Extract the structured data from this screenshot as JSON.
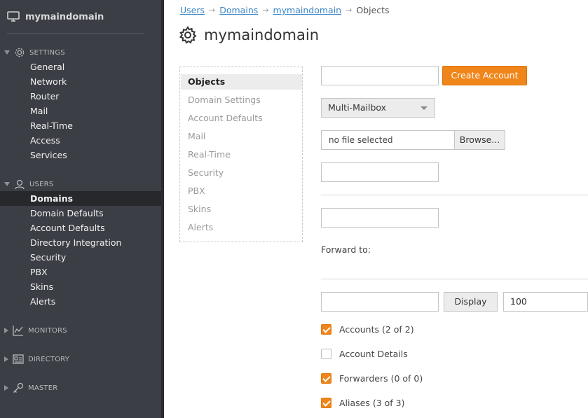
{
  "brand": {
    "name": "mymaindomain"
  },
  "sidebar": {
    "settings": {
      "label": "SETTINGS",
      "items": [
        "General",
        "Network",
        "Router",
        "Mail",
        "Real-Time",
        "Access",
        "Services"
      ]
    },
    "users": {
      "label": "USERS",
      "items": [
        "Domains",
        "Domain Defaults",
        "Account Defaults",
        "Directory Integration",
        "Security",
        "PBX",
        "Skins",
        "Alerts"
      ],
      "active": "Domains"
    },
    "monitors": {
      "label": "MONITORS"
    },
    "directory": {
      "label": "DIRECTORY"
    },
    "master": {
      "label": "MASTER"
    }
  },
  "breadcrumb": {
    "items": [
      "Users",
      "Domains",
      "mymaindomain"
    ],
    "current": "Objects"
  },
  "page": {
    "title": "mymaindomain"
  },
  "subnav": {
    "items": [
      "Objects",
      "Domain Settings",
      "Account Defaults",
      "Mail",
      "Real-Time",
      "Security",
      "PBX",
      "Skins",
      "Alerts"
    ],
    "active": "Objects"
  },
  "form": {
    "create_account_label": "Create Account",
    "account_type": "Multi-Mailbox",
    "file_status": "no file selected",
    "browse_label": "Browse...",
    "forward_to_label": "Forward to:",
    "display_label": "Display",
    "display_count": "100"
  },
  "filters": [
    {
      "label": "Accounts (2 of 2)",
      "checked": true
    },
    {
      "label": "Account Details",
      "checked": false
    },
    {
      "label": "Forwarders (0 of 0)",
      "checked": true
    },
    {
      "label": "Aliases (3 of 3)",
      "checked": true
    }
  ],
  "colors": {
    "accent": "#f08519",
    "sidebar": "#3b3e44",
    "link": "#3a86c8"
  }
}
